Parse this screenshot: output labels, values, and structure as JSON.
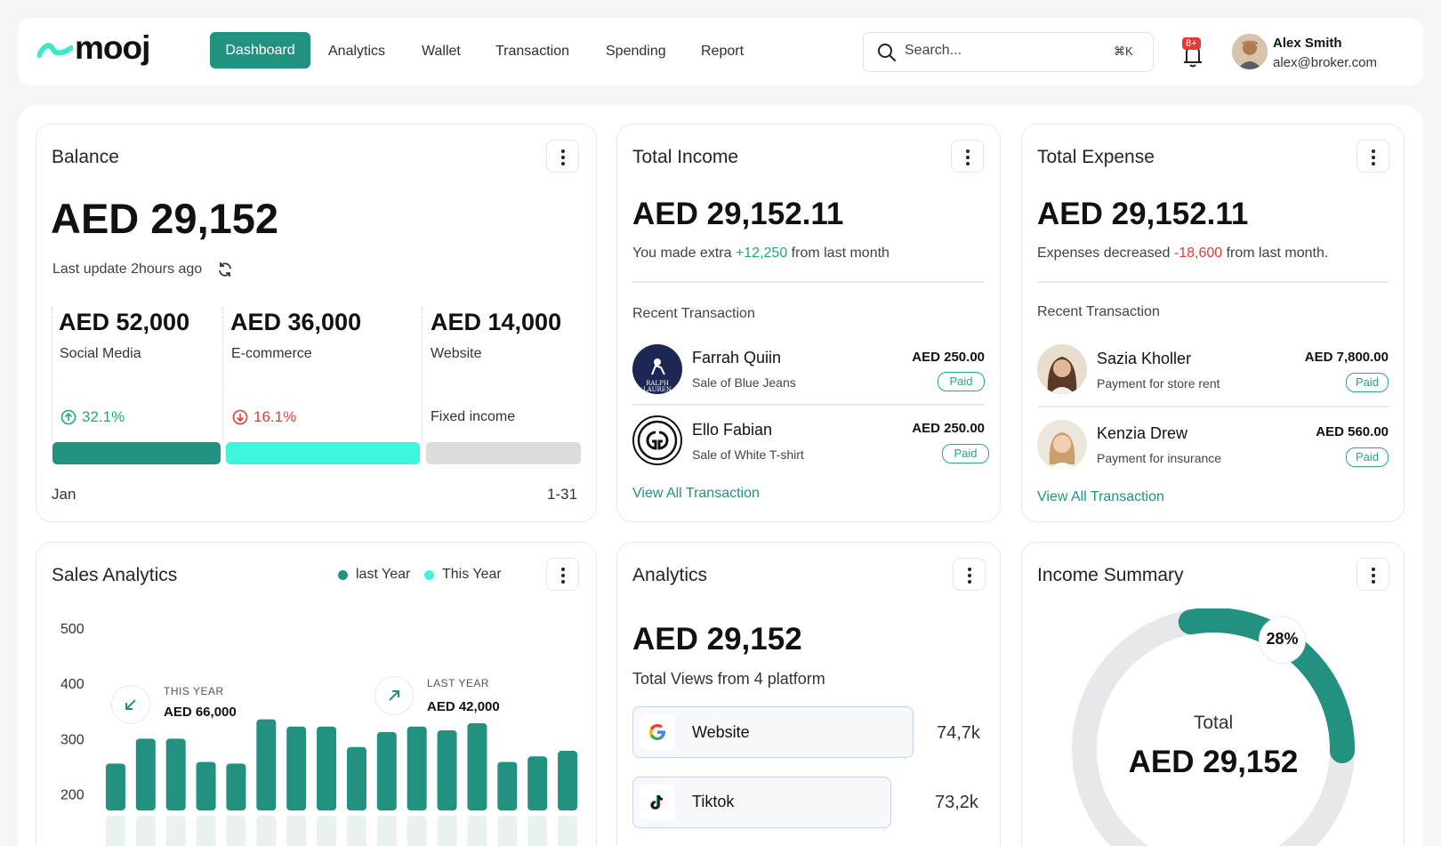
{
  "brand": {
    "name": "mooj"
  },
  "nav": {
    "items": [
      "Dashboard",
      "Analytics",
      "Wallet",
      "Transaction",
      "Spending",
      "Report"
    ],
    "active": "Dashboard"
  },
  "search": {
    "placeholder": "Search...",
    "shortcut": "⌘K"
  },
  "notifications": {
    "badge": "8+"
  },
  "user": {
    "name": "Alex Smith",
    "email": "alex@broker.com"
  },
  "balance": {
    "title": "Balance",
    "amount": "AED 29,152",
    "last_update": "Last update 2hours ago",
    "segments": [
      {
        "amount": "AED 52,000",
        "label": "Social Media",
        "change": "32.1%",
        "direction": "up"
      },
      {
        "amount": "AED 36,000",
        "label": "E-commerce",
        "change": "16.1%",
        "direction": "down"
      },
      {
        "amount": "AED 14,000",
        "label": "Website",
        "note": "Fixed income"
      }
    ],
    "period_start": "Jan",
    "period_range": "1-31",
    "colors": {
      "social": "#239180",
      "ecommerce": "#3ef5dd",
      "website": "#dcdcdc"
    }
  },
  "income": {
    "title": "Total Income",
    "amount": "AED 29,152.11",
    "note_prefix": "You made extra",
    "note_value": "+12,250",
    "note_suffix": "from last month",
    "recent_label": "Recent Transaction",
    "transactions": [
      {
        "name": "Farrah Quiin",
        "desc": "Sale of Blue Jeans",
        "amount": "AED 250.00",
        "status": "Paid"
      },
      {
        "name": "Ello Fabian",
        "desc": "Sale of White T-shirt",
        "amount": "AED 250.00",
        "status": "Paid"
      }
    ],
    "view_all": "View All Transaction"
  },
  "expense": {
    "title": "Total Expense",
    "amount": "AED 29,152.11",
    "note_prefix": "Expenses decreased",
    "note_value": "-18,600",
    "note_suffix": "from last month.",
    "recent_label": "Recent Transaction",
    "transactions": [
      {
        "name": "Sazia Kholler",
        "desc": "Payment for store rent",
        "amount": "AED 7,800.00",
        "status": "Paid"
      },
      {
        "name": "Kenzia Drew",
        "desc": "Payment for insurance",
        "amount": "AED 560.00",
        "status": "Paid"
      }
    ],
    "view_all": "View All Transaction"
  },
  "sales": {
    "title": "Sales Analytics",
    "legend": [
      "last Year",
      "This Year"
    ],
    "this_year_label": "THIS YEAR",
    "this_year_value": "AED 66,000",
    "last_year_label": "LAST YEAR",
    "last_year_value": "AED 42,000"
  },
  "chart_data": {
    "type": "bar",
    "title": "Sales Analytics",
    "yticks": [
      500,
      400,
      300,
      200
    ],
    "ylim": [
      180,
      500
    ],
    "series": [
      {
        "name": "This Year",
        "color": "#239180",
        "values": [
          255,
          300,
          300,
          258,
          255,
          335,
          322,
          322,
          285,
          312,
          322,
          315,
          328,
          258,
          268,
          278
        ]
      }
    ],
    "legend": "top-right",
    "grid": false
  },
  "analytics": {
    "title": "Analytics",
    "amount": "AED 29,152",
    "subtitle": "Total Views from 4 platform",
    "platforms": [
      {
        "name": "Website",
        "views": "74,7k",
        "icon": "google-icon"
      },
      {
        "name": "Tiktok",
        "views": "73,2k",
        "icon": "tiktok-icon"
      }
    ]
  },
  "income_summary": {
    "title": "Income Summary",
    "percent_label": "28%",
    "percent": 28,
    "total_label": "Total",
    "total_amount": "AED 29,152",
    "colors": {
      "track": "#e7e8ea",
      "fill": "#239180"
    }
  }
}
